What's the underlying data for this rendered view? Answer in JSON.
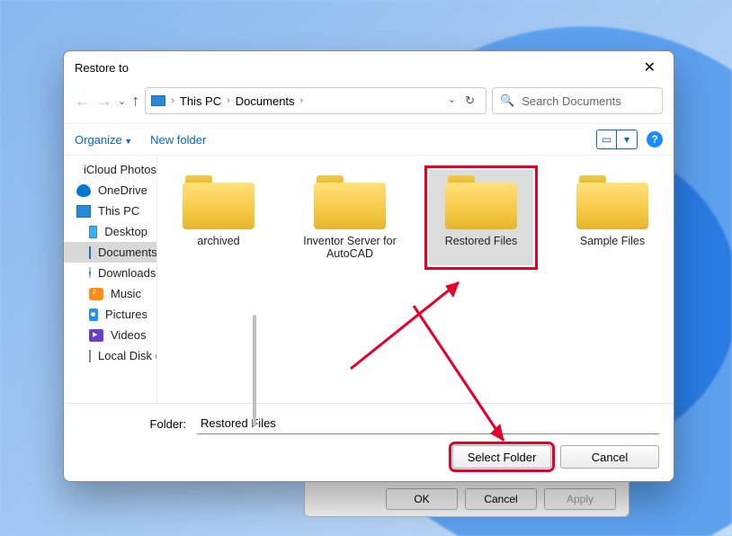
{
  "dialog": {
    "title": "Restore to",
    "breadcrumb": {
      "root": "This PC",
      "folder": "Documents"
    },
    "search_placeholder": "Search Documents",
    "toolbar": {
      "organize": "Organize",
      "new_folder": "New folder"
    },
    "sidebar": [
      {
        "icon": "icloud",
        "label": "iCloud Photos"
      },
      {
        "icon": "onedrive",
        "label": "OneDrive"
      },
      {
        "icon": "pc",
        "label": "This PC",
        "bold": true
      },
      {
        "icon": "desktop",
        "label": "Desktop",
        "child": true
      },
      {
        "icon": "doc",
        "label": "Documents",
        "child": true,
        "selected": true
      },
      {
        "icon": "down",
        "label": "Downloads",
        "child": true
      },
      {
        "icon": "music",
        "label": "Music",
        "child": true
      },
      {
        "icon": "pic",
        "label": "Pictures",
        "child": true
      },
      {
        "icon": "vid",
        "label": "Videos",
        "child": true
      },
      {
        "icon": "disk",
        "label": "Local Disk (C:)",
        "child": true
      }
    ],
    "folders": [
      {
        "name": "archived"
      },
      {
        "name": "Inventor Server for AutoCAD"
      },
      {
        "name": "Restored Files",
        "selected": true,
        "highlighted": true
      },
      {
        "name": "Sample Files"
      }
    ],
    "footer": {
      "label": "Folder:",
      "value": "Restored Files",
      "select": "Select Folder",
      "cancel": "Cancel"
    }
  },
  "behind": {
    "ok": "OK",
    "cancel": "Cancel",
    "apply": "Apply"
  }
}
